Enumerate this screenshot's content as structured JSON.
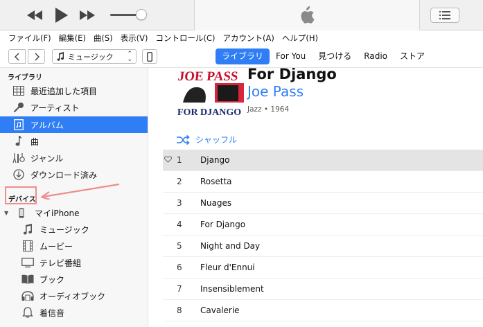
{
  "menu": [
    "ファイル(F)",
    "編集(E)",
    "曲(S)",
    "表示(V)",
    "コントロール(C)",
    "アカウント(A)",
    "ヘルプ(H)"
  ],
  "nav": {
    "media_label": "ミュージック",
    "tabs": [
      {
        "label": "ライブラリ",
        "active": true
      },
      {
        "label": "For You",
        "active": false
      },
      {
        "label": "見つける",
        "active": false
      },
      {
        "label": "Radio",
        "active": false
      },
      {
        "label": "ストア",
        "active": false
      }
    ]
  },
  "sidebar": {
    "library_header": "ライブラリ",
    "library_items": [
      {
        "label": "最近追加した項目",
        "icon": "grid-icon",
        "active": false
      },
      {
        "label": "アーティスト",
        "icon": "microphone-icon",
        "active": false
      },
      {
        "label": "アルバム",
        "icon": "album-icon",
        "active": true
      },
      {
        "label": "曲",
        "icon": "music-note-icon",
        "active": false
      },
      {
        "label": "ジャンル",
        "icon": "genre-icon",
        "active": false
      },
      {
        "label": "ダウンロード済み",
        "icon": "download-icon",
        "active": false
      }
    ],
    "devices_header": "デバイス",
    "device_name": "マイiPhone",
    "device_items": [
      {
        "label": "ミュージック",
        "icon": "music-note-icon"
      },
      {
        "label": "ムービー",
        "icon": "film-icon"
      },
      {
        "label": "テレビ番組",
        "icon": "tv-icon"
      },
      {
        "label": "ブック",
        "icon": "book-icon"
      },
      {
        "label": "オーディオブック",
        "icon": "audiobook-icon"
      },
      {
        "label": "着信音",
        "icon": "bell-icon"
      }
    ],
    "highlight_color": "#f08c8c"
  },
  "album": {
    "title": "For Django",
    "artist": "Joe Pass",
    "meta": "Jazz • 1964",
    "cover_text_top": "JOE PASS",
    "cover_text_bottom": "FOR DJANGO",
    "shuffle_label": "シャッフル"
  },
  "tracks": [
    {
      "num": "1",
      "name": "Django",
      "selected": true
    },
    {
      "num": "2",
      "name": "Rosetta",
      "selected": false
    },
    {
      "num": "3",
      "name": "Nuages",
      "selected": false
    },
    {
      "num": "4",
      "name": "For Django",
      "selected": false
    },
    {
      "num": "5",
      "name": "Night and Day",
      "selected": false
    },
    {
      "num": "6",
      "name": "Fleur d'Ennui",
      "selected": false
    },
    {
      "num": "7",
      "name": "Insensiblement",
      "selected": false
    },
    {
      "num": "8",
      "name": "Cavalerie",
      "selected": false
    }
  ],
  "colors": {
    "accent": "#2f7ef6",
    "annotation": "#f08c8c"
  }
}
